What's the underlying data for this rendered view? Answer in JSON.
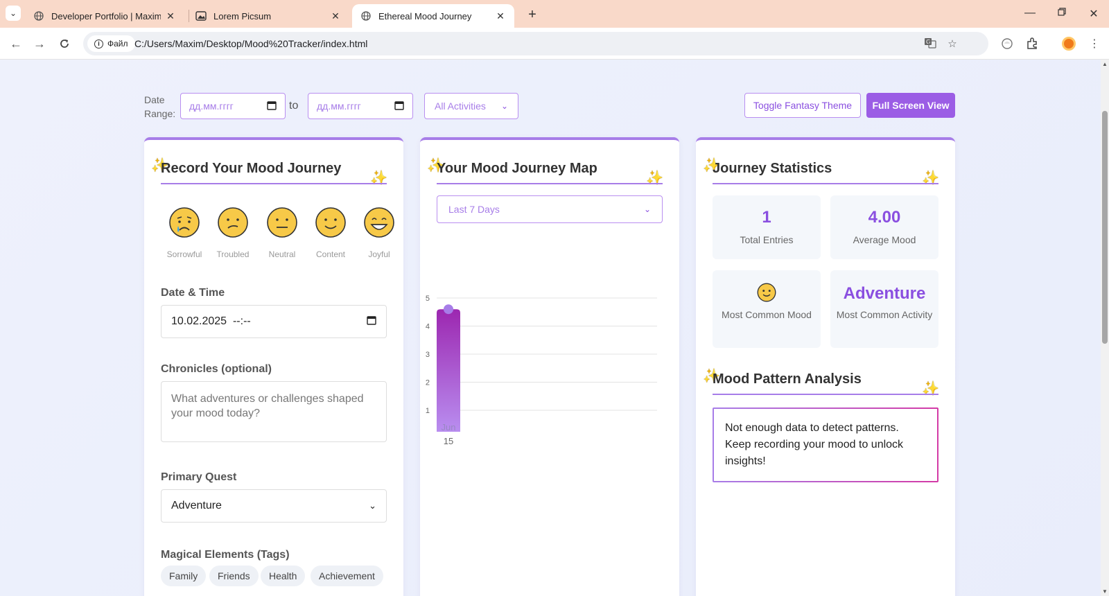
{
  "browser": {
    "tabs": [
      {
        "title": "Developer Portfolio | Maxim Mi",
        "icon": "globe-icon",
        "active": false
      },
      {
        "title": "Lorem Picsum",
        "icon": "image-icon",
        "active": false
      },
      {
        "title": "Ethereal Mood Journey",
        "icon": "globe-icon",
        "active": true
      }
    ],
    "site_chip": "Файл",
    "url": "C:/Users/Maxim/Desktop/Mood%20Tracker/index.html"
  },
  "filters": {
    "date_range_label": "Date Range:",
    "date_from_placeholder": "дд.мм.гггг",
    "to_label": "to",
    "date_to_placeholder": "дд.мм.гггг",
    "activity_select": "All Activities",
    "toggle_theme": "Toggle Fantasy Theme",
    "full_screen": "Full Screen View"
  },
  "record": {
    "title": "Record Your Mood Journey",
    "moods": [
      {
        "label": "Sorrowful",
        "icon": "sorrowful-face-icon"
      },
      {
        "label": "Troubled",
        "icon": "troubled-face-icon"
      },
      {
        "label": "Neutral",
        "icon": "neutral-face-icon"
      },
      {
        "label": "Content",
        "icon": "content-face-icon"
      },
      {
        "label": "Joyful",
        "icon": "joyful-face-icon"
      }
    ],
    "datetime_label": "Date & Time",
    "datetime_value": "10.02.2025  --:--",
    "chronicles_label": "Chronicles (optional)",
    "chronicles_placeholder": "What adventures or challenges shaped your mood today?",
    "quest_label": "Primary Quest",
    "quest_value": "Adventure",
    "tags_label": "Magical Elements (Tags)",
    "tags": [
      "Family",
      "Friends",
      "Health",
      "Achievement"
    ]
  },
  "map": {
    "title": "Your Mood Journey Map",
    "period": "Last 7 Days"
  },
  "chart_data": {
    "type": "bar",
    "categories": [
      "Jun 15"
    ],
    "category_lines": [
      [
        "Jun",
        "15"
      ]
    ],
    "values": [
      4.6
    ],
    "ylim": [
      0,
      5
    ],
    "yticks": [
      1,
      2,
      3,
      4,
      5
    ],
    "grid": true,
    "bar_color_top": "#9c27b0",
    "bar_color_bottom": "#b98ef0",
    "point_color": "#a77de8"
  },
  "stats": {
    "title": "Journey Statistics",
    "total_entries_value": "1",
    "total_entries_label": "Total Entries",
    "average_mood_value": "4.00",
    "average_mood_label": "Average Mood",
    "common_mood_icon": "content-face-icon",
    "common_mood_label": "Most Common Mood",
    "common_activity_value": "Adventure",
    "common_activity_label": "Most Common Activity",
    "pattern_title": "Mood Pattern Analysis",
    "pattern_text": "Not enough data to detect patterns. Keep recording your mood to unlock insights!"
  },
  "colors": {
    "accent": "#9b5de5",
    "accent_light": "#a77de8",
    "emoji_yellow": "#f7c948"
  }
}
